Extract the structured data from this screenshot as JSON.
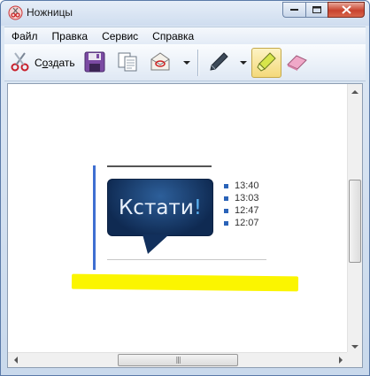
{
  "window": {
    "title": "Ножницы",
    "caption_buttons": [
      "minimize",
      "maximize",
      "close"
    ]
  },
  "menu": {
    "items": [
      "Файл",
      "Правка",
      "Сервис",
      "Справка"
    ]
  },
  "toolbar": {
    "new_label_prefix": "С",
    "new_label_underlined": "о",
    "new_label_suffix": "здать",
    "icons": [
      "scissors-icon",
      "save-icon",
      "copy-icon",
      "send-icon",
      "pen-icon",
      "highlighter-icon",
      "eraser-icon"
    ],
    "active_tool": "highlighter"
  },
  "snip": {
    "bubble_text": "Кстати",
    "bubble_mark": "!",
    "times": [
      "13:40",
      "13:03",
      "12:47",
      "12:07"
    ],
    "highlight_color": "#fbf500",
    "accent_blue": "#3f6fd1"
  }
}
